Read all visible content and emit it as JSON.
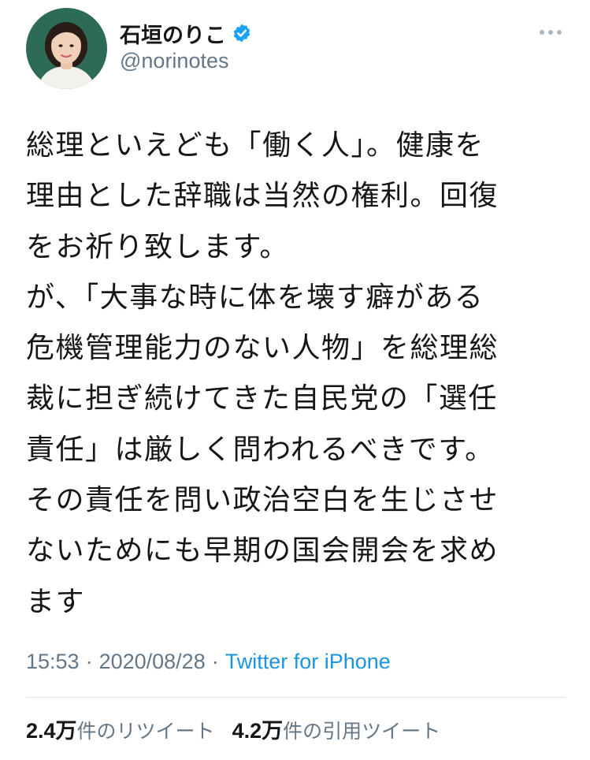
{
  "user": {
    "display_name": "石垣のりこ",
    "handle": "@norinotes",
    "verified": true
  },
  "tweet": {
    "text": "総理といえども「働く人」。健康を\n理由とした辞職は当然の権利。回復\nをお祈り致します。\nが、「大事な時に体を壊す癖がある\n危機管理能力のない人物」を総理総\n裁に担ぎ続けてきた自民党の「選任\n責任」は厳しく問われるべきです。\nその責任を問い政治空白を生じさせ\nないためにも早期の国会開会を求め\nます",
    "time": "15:53",
    "separator1": "·",
    "date": "2020/08/28",
    "separator2": "·",
    "source": "Twitter for iPhone"
  },
  "stats": {
    "retweets_count": "2.4万",
    "retweets_label": "件のリツイート",
    "quotes_count": "4.2万",
    "quotes_label": "件の引用ツイート"
  },
  "icons": {
    "verified": "verified-badge-icon",
    "more": "more-options-icon"
  },
  "colors": {
    "text_primary": "#14171a",
    "text_secondary": "#657786",
    "link": "#1b95e0",
    "verified_badge": "#1da1f2",
    "avatar_background": "#2e6b57",
    "divider": "#e1e8ed"
  }
}
